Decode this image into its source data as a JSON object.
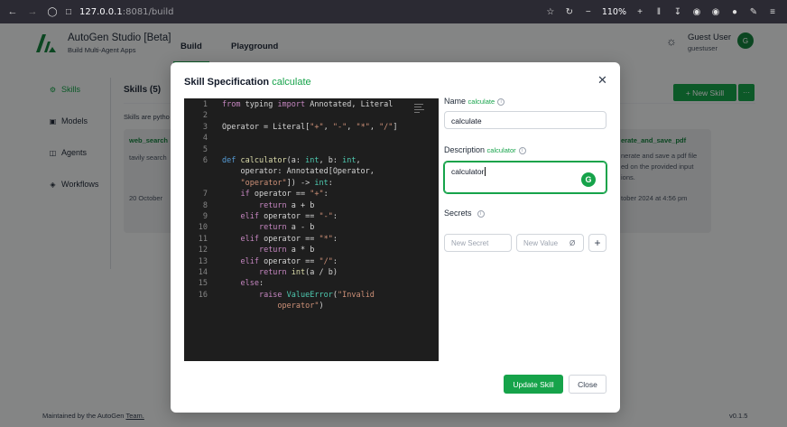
{
  "browser": {
    "url_host": "127.0.0.1",
    "url_rest": ":8081/build",
    "zoom": "110%"
  },
  "app": {
    "title": "AutoGen Studio [Beta]",
    "subtitle": "Build Multi-Agent Apps",
    "tabs": [
      {
        "label": "Build"
      },
      {
        "label": "Playground"
      }
    ],
    "user": {
      "name": "Guest User",
      "email": "guestuser",
      "initial": "G"
    },
    "sidebar": [
      {
        "label": "Skills"
      },
      {
        "label": "Models"
      },
      {
        "label": "Agents"
      },
      {
        "label": "Workflows"
      }
    ],
    "skills_heading": "Skills (5)",
    "skills_desc": "Skills are pytho",
    "new_skill_label": "+ New Skill",
    "more_label": "···",
    "cards": {
      "left": {
        "title": "web_search",
        "text": "tavily search",
        "date": "20 October"
      },
      "right": {
        "title": "erate_and_save_pdf",
        "lines": [
          "nerate and save a pdf file",
          "ed on the provided input",
          "ions."
        ],
        "date": "tober 2024 at 4:56 pm"
      }
    },
    "footer": {
      "maintained_prefix": "Maintained by the AutoGen",
      "maintained_link": "Team.",
      "version": "v0.1.5"
    }
  },
  "modal": {
    "title": "Skill Specification",
    "title_accent": "calculate",
    "name_label": "Name",
    "name_accent": "calculate",
    "name_value": "calculate",
    "description_label": "Description",
    "description_accent": "calculator",
    "description_value": "calculator",
    "secrets_label": "Secrets",
    "secret_name_placeholder": "New Secret",
    "secret_value_placeholder": "New Value",
    "update_label": "Update Skill",
    "close_label": "Close",
    "code_lines": [
      {
        "n": "1",
        "html": "<span class='kw'>from</span> typing <span class='kw'>import</span> Annotated, Literal"
      },
      {
        "n": "2",
        "html": ""
      },
      {
        "n": "3",
        "html": "Operator = Literal[<span class='str'>\"+\"</span>, <span class='str'>\"-\"</span>, <span class='str'>\"*\"</span>, <span class='str'>\"/\"</span>]"
      },
      {
        "n": "4",
        "html": ""
      },
      {
        "n": "5",
        "html": ""
      },
      {
        "n": "6",
        "html": "<span class='kw2'>def</span> <span class='fn'>calculator</span>(a: <span class='cls'>int</span>, b: <span class='cls'>int</span>,"
      },
      {
        "n": "",
        "html": "    operator: Annotated[Operator,"
      },
      {
        "n": "",
        "html": "    <span class='str'>\"operator\"</span>]) -> <span class='cls'>int</span>:"
      },
      {
        "n": "7",
        "html": "    <span class='kw'>if</span> operator == <span class='str'>\"+\"</span>:"
      },
      {
        "n": "8",
        "html": "        <span class='kw'>return</span> a + b"
      },
      {
        "n": "9",
        "html": "    <span class='kw'>elif</span> operator == <span class='str'>\"-\"</span>:"
      },
      {
        "n": "10",
        "html": "        <span class='kw'>return</span> a - b"
      },
      {
        "n": "11",
        "html": "    <span class='kw'>elif</span> operator == <span class='str'>\"*\"</span>:"
      },
      {
        "n": "12",
        "html": "        <span class='kw'>return</span> a * b"
      },
      {
        "n": "13",
        "html": "    <span class='kw'>elif</span> operator == <span class='str'>\"/\"</span>:"
      },
      {
        "n": "14",
        "html": "        <span class='kw'>return</span> <span class='fn'>int</span>(a / b)"
      },
      {
        "n": "15",
        "html": "    <span class='kw'>else</span>:"
      },
      {
        "n": "16",
        "html": "        <span class='kw'>raise</span> <span class='cls'>ValueError</span>(<span class='str'>\"Invalid</span>"
      },
      {
        "n": "",
        "html": "            <span class='str'>operator\"</span>)"
      }
    ]
  }
}
